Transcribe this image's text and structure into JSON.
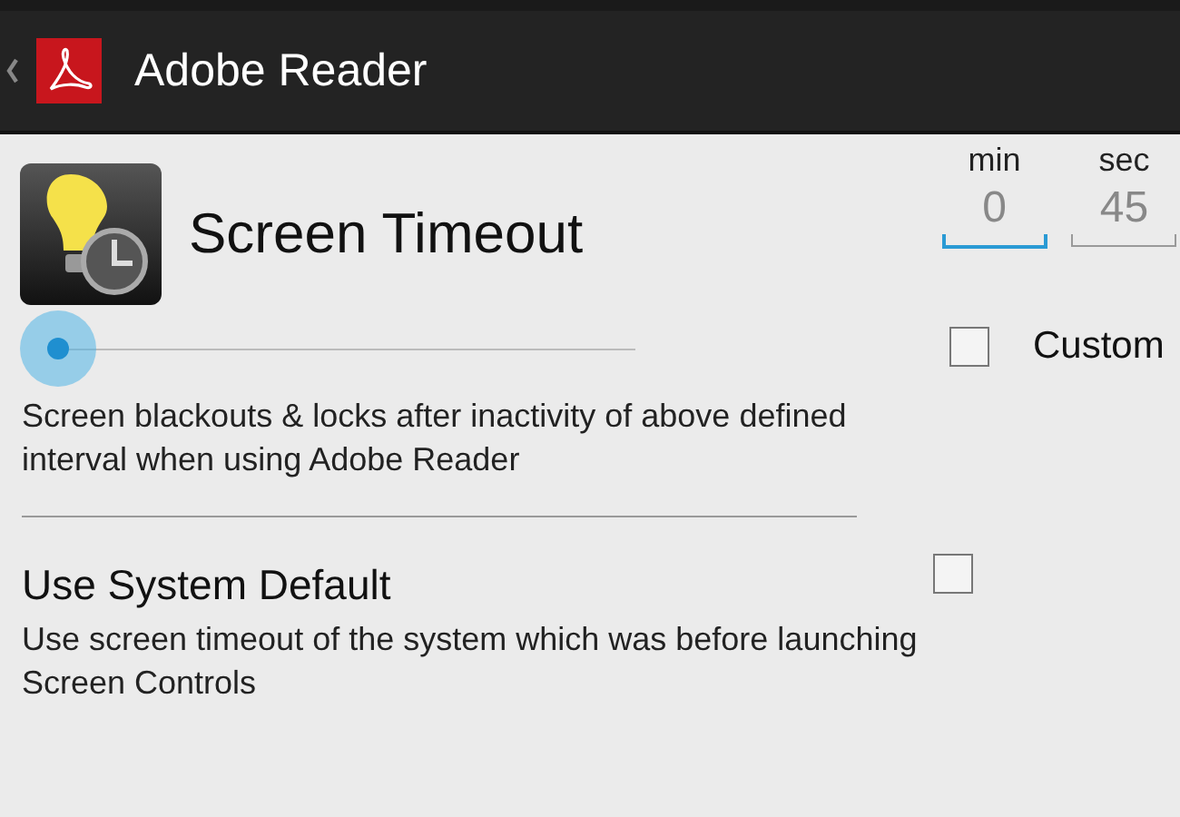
{
  "action_bar": {
    "title": "Adobe Reader"
  },
  "timeout": {
    "title": "Screen Timeout",
    "description": "Screen blackouts & locks after inactivity of above defined interval when using Adobe Reader",
    "fields": [
      {
        "label": "min",
        "value": "0",
        "focused": true
      },
      {
        "label": "sec",
        "value": "45",
        "focused": false
      }
    ],
    "custom": {
      "label": "Custom",
      "checked": false
    }
  },
  "system_default": {
    "title": "Use System Default",
    "description": "Use screen timeout of the system which was before launching Screen Controls",
    "checked": false
  }
}
